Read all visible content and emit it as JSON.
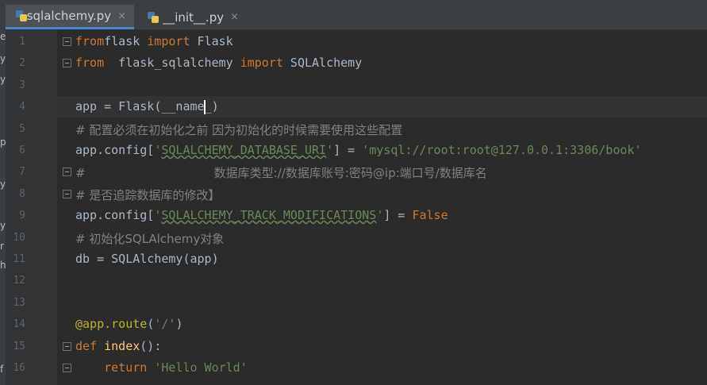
{
  "left_strip": [
    "e",
    "y",
    "y",
    "p",
    "y",
    "y",
    "r",
    "h",
    "f"
  ],
  "tabs": [
    {
      "label": "sqlalchemy.py",
      "close": "×",
      "active": true
    },
    {
      "label": "__init__.py",
      "close": "×",
      "active": false
    }
  ],
  "lines": [
    {
      "n": "1",
      "seg": [
        [
          "kw",
          "from"
        ],
        [
          "",
          "flask "
        ],
        [
          "kw",
          "import"
        ],
        [
          "",
          " Flask"
        ]
      ]
    },
    {
      "n": "2",
      "seg": [
        [
          "kw",
          "from"
        ],
        [
          "",
          "  flask_sqlalchemy "
        ],
        [
          "kw",
          "import"
        ],
        [
          "",
          " SQLAlchemy"
        ]
      ]
    },
    {
      "n": "3",
      "seg": []
    },
    {
      "n": "4",
      "seg": [
        [
          "",
          "app = Flask(__name"
        ],
        [
          "caret",
          ""
        ],
        [
          "",
          "_)"
        ]
      ]
    },
    {
      "n": "5",
      "seg": [
        [
          "cm",
          "# 配置必须在初始化之前 因为初始化的时候需要使用这些配置"
        ]
      ]
    },
    {
      "n": "6",
      "seg": [
        [
          "",
          "app.config["
        ],
        [
          "str",
          "'"
        ],
        [
          "sq",
          "SQLALCHEMY_DATABASE_URI"
        ],
        [
          "str",
          "'"
        ],
        [
          "",
          "] = "
        ],
        [
          "str",
          "'mysql://root:root@127.0.0.1:3306/book'"
        ]
      ]
    },
    {
      "n": "7",
      "seg": [
        [
          "cm",
          "#                                  数据库类型://数据库账号:密码@ip:端口号/数据库名"
        ]
      ]
    },
    {
      "n": "8",
      "seg": [
        [
          "cm",
          "# 是否追踪数据库的修改】"
        ]
      ]
    },
    {
      "n": "9",
      "seg": [
        [
          "",
          "app.config["
        ],
        [
          "str",
          "'"
        ],
        [
          "sq",
          "SQLALCHEMY_TRACK_MODIFICATIONS"
        ],
        [
          "str",
          "'"
        ],
        [
          "",
          "] = "
        ],
        [
          "kw",
          "False"
        ]
      ]
    },
    {
      "n": "10",
      "seg": [
        [
          "cm",
          "# 初始化SQLAlchemy对象"
        ]
      ]
    },
    {
      "n": "11",
      "seg": [
        [
          "",
          "db = SQLAlchemy(app)"
        ]
      ]
    },
    {
      "n": "12",
      "seg": []
    },
    {
      "n": "13",
      "seg": []
    },
    {
      "n": "14",
      "seg": [
        [
          "deco",
          "@app.route"
        ],
        [
          "",
          "("
        ],
        [
          "str",
          "'/'"
        ],
        [
          "",
          ")"
        ]
      ]
    },
    {
      "n": "15",
      "seg": [
        [
          "kw",
          "def "
        ],
        [
          "fn",
          "index"
        ],
        [
          "",
          "():"
        ]
      ]
    },
    {
      "n": "16",
      "seg": [
        [
          "",
          "    "
        ],
        [
          "kw",
          "return "
        ],
        [
          "str",
          "'Hello World'"
        ]
      ]
    }
  ]
}
